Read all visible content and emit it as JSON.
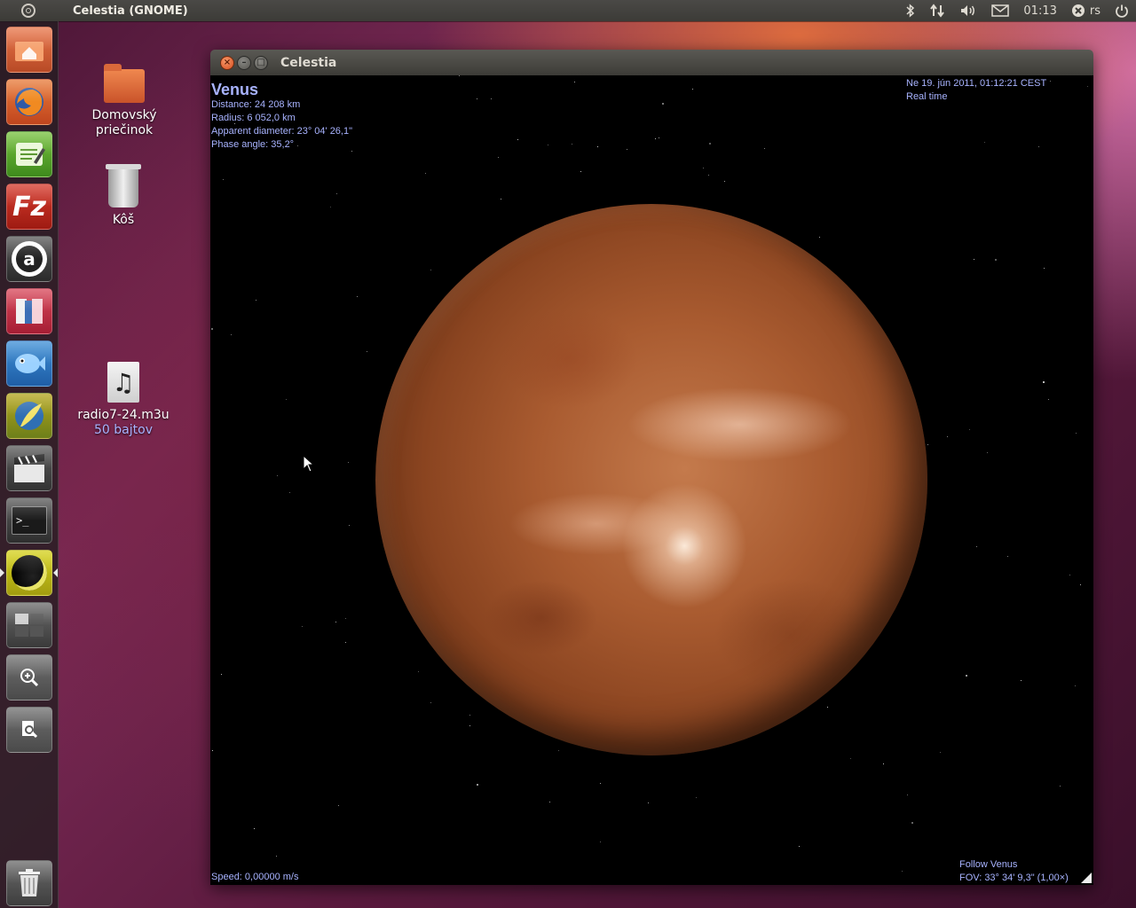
{
  "top_panel": {
    "app_title": "Celestia (GNOME)",
    "clock": "01:13",
    "user": "rs"
  },
  "launcher": {
    "items": [
      {
        "name": "home-folder",
        "icon": "home-folder-icon"
      },
      {
        "name": "firefox",
        "icon": "firefox-icon"
      },
      {
        "name": "gedit",
        "icon": "text-editor-icon"
      },
      {
        "name": "filezilla",
        "icon": "filezilla-icon",
        "glyph": "Fz"
      },
      {
        "name": "audacious",
        "icon": "audacious-icon",
        "glyph": "a"
      },
      {
        "name": "books",
        "icon": "books-icon"
      },
      {
        "name": "fish",
        "icon": "fish-icon"
      },
      {
        "name": "feather",
        "icon": "feather-icon"
      },
      {
        "name": "video-editor",
        "icon": "clapperboard-icon"
      },
      {
        "name": "terminal",
        "icon": "terminal-icon",
        "glyph": ">_"
      },
      {
        "name": "celestia",
        "icon": "celestia-icon"
      },
      {
        "name": "workspace-switcher",
        "icon": "workspace-switcher-icon"
      },
      {
        "name": "applications-lens",
        "icon": "zoom-icon"
      },
      {
        "name": "files-lens",
        "icon": "file-search-icon"
      },
      {
        "name": "trash",
        "icon": "trash-icon"
      }
    ]
  },
  "desktop": {
    "icons": [
      {
        "label": "Domovský priečinok",
        "icon": "home-folder-icon"
      },
      {
        "label": "Kôš",
        "icon": "trash-icon"
      },
      {
        "label": "radio7-24.m3u",
        "sublabel": "50 bajtov",
        "icon": "music-file-icon"
      }
    ]
  },
  "window": {
    "title": "Celestia",
    "hud": {
      "object_name": "Venus",
      "distance": "Distance: 24 208 km",
      "radius": "Radius: 6 052,0 km",
      "apparent_diameter": "Apparent diameter: 23° 04' 26,1\"",
      "phase_angle": "Phase angle: 35,2°",
      "datetime": "Ne 19. jún 2011, 01:12:21 CEST",
      "time_mode": "Real time",
      "speed": "Speed: 0,00000 m/s",
      "follow": "Follow Venus",
      "fov": "FOV: 33° 34' 9,3\" (1,00×)"
    }
  },
  "colors": {
    "hud_text": "#a8b3ff",
    "panel_bg": "#3c3b37",
    "venus_base": "#a95b30"
  }
}
